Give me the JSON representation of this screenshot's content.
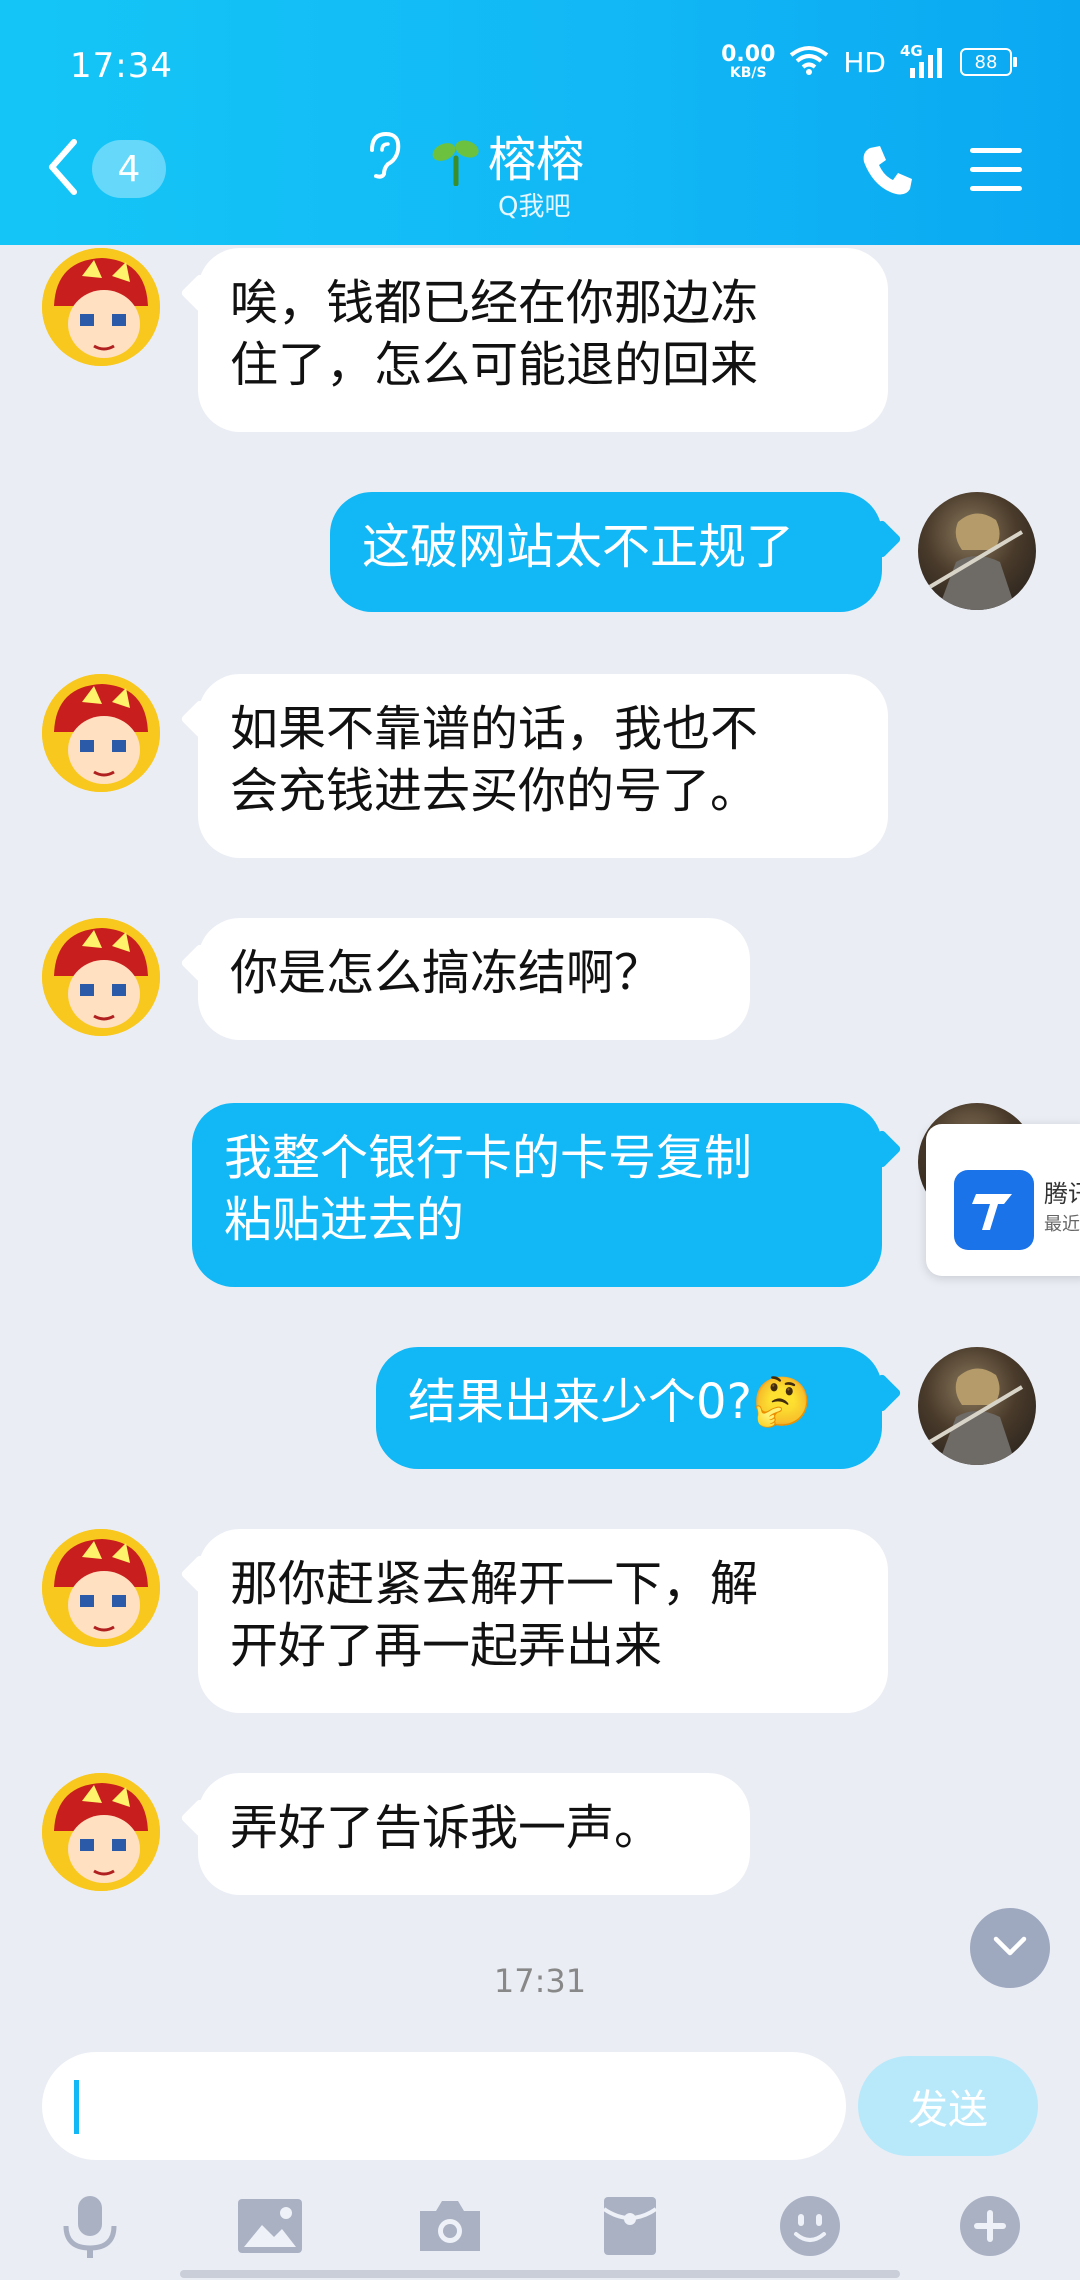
{
  "status_bar": {
    "time": "17:34",
    "net_speed_value": "0.00",
    "net_speed_unit": "KB/S",
    "hd": "HD",
    "signal_type": "4G",
    "battery": "88"
  },
  "header": {
    "unread_count": "4",
    "contact_name": "榕榕",
    "contact_status": "Q我吧"
  },
  "messages": [
    {
      "from": "other",
      "text": "唉，钱都已经在你那边冻\n住了，怎么可能退的回来"
    },
    {
      "from": "me",
      "text": "这破网站太不正规了"
    },
    {
      "from": "other",
      "text": "如果不靠谱的话，我也不\n会充钱进去买你的号了。"
    },
    {
      "from": "other",
      "text": "你是怎么搞冻结啊？"
    },
    {
      "from": "me",
      "text": "我整个银行卡的卡号复制\n粘贴进去的"
    },
    {
      "from": "me",
      "text": "结果出来少个0?🤔"
    },
    {
      "from": "other",
      "text": "那你赶紧去解开一下，解\n开好了再一起弄出来"
    },
    {
      "from": "other",
      "text": "弄好了告诉我一声。"
    }
  ],
  "timestamp": "17:31",
  "floating_card": {
    "title": "腾讯",
    "subtitle": "最近"
  },
  "input": {
    "value": "",
    "placeholder": ""
  },
  "send_label": "发送",
  "toolbar": [
    "microphone-icon",
    "image-icon",
    "camera-icon",
    "red-packet-icon",
    "emoji-icon",
    "plus-icon"
  ],
  "colors": {
    "accent": "#12b7f5",
    "background": "#eaedf4",
    "send_disabled": "#b8e9fb"
  }
}
